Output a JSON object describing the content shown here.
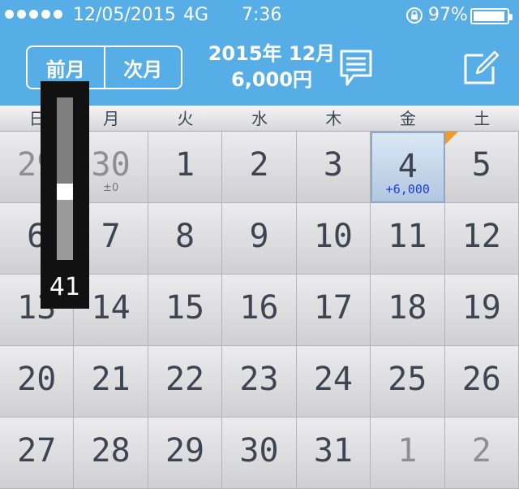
{
  "status_bar": {
    "signal_icon": "signal-dots-icon",
    "date": "12/05/2015",
    "network": "4G",
    "time": "7:36",
    "lock_icon": "rotation-lock-icon",
    "battery_percent": "97%",
    "battery_level": 0.97
  },
  "header": {
    "prev_label": "前月",
    "next_label": "次月",
    "title": "2015年 12月",
    "total": "6,000円",
    "memo_icon": "memo-bubble-icon",
    "edit_icon": "edit-pencil-icon",
    "background": "#57aee6"
  },
  "weekdays": [
    "日",
    "月",
    "火",
    "水",
    "木",
    "金",
    "土"
  ],
  "calendar": {
    "weeks": [
      [
        {
          "day": "29",
          "other": true
        },
        {
          "day": "30",
          "other": true,
          "sub": "±0"
        },
        {
          "day": "1"
        },
        {
          "day": "2"
        },
        {
          "day": "3"
        },
        {
          "day": "4",
          "selected": true,
          "sub": "+6,000"
        },
        {
          "day": "5",
          "marker": true
        }
      ],
      [
        {
          "day": "6"
        },
        {
          "day": "7"
        },
        {
          "day": "8"
        },
        {
          "day": "9"
        },
        {
          "day": "10"
        },
        {
          "day": "11"
        },
        {
          "day": "12"
        }
      ],
      [
        {
          "day": "13"
        },
        {
          "day": "14"
        },
        {
          "day": "15"
        },
        {
          "day": "16"
        },
        {
          "day": "17"
        },
        {
          "day": "18"
        },
        {
          "day": "19"
        }
      ],
      [
        {
          "day": "20"
        },
        {
          "day": "21"
        },
        {
          "day": "22"
        },
        {
          "day": "23"
        },
        {
          "day": "24"
        },
        {
          "day": "25"
        },
        {
          "day": "26"
        }
      ],
      [
        {
          "day": "27"
        },
        {
          "day": "28"
        },
        {
          "day": "29"
        },
        {
          "day": "30"
        },
        {
          "day": "31"
        },
        {
          "day": "1",
          "other": true
        },
        {
          "day": "2",
          "other": true
        }
      ]
    ],
    "selected_color": "#1b3fe0",
    "marker_color": "#f09a2c"
  },
  "volume_overlay": {
    "value": "41",
    "level": 0.41
  }
}
